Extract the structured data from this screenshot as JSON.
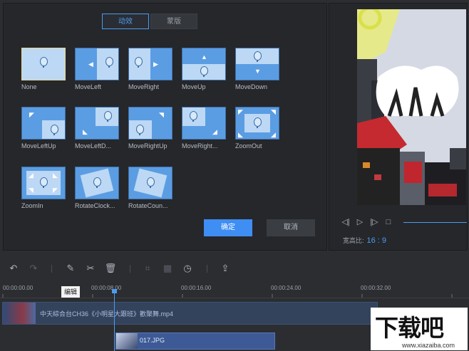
{
  "tabs": [
    {
      "label": "动效",
      "active": true
    },
    {
      "label": "蒙版",
      "active": false
    }
  ],
  "effects": [
    {
      "label": "None",
      "selected": true
    },
    {
      "label": "MoveLeft"
    },
    {
      "label": "MoveRight"
    },
    {
      "label": "MoveUp"
    },
    {
      "label": "MoveDown"
    },
    {
      "label": "MoveLeftUp"
    },
    {
      "label": "MoveLeftD..."
    },
    {
      "label": "MoveRightUp"
    },
    {
      "label": "MoveRight..."
    },
    {
      "label": "ZoomOut"
    },
    {
      "label": "ZoomIn"
    },
    {
      "label": "RotateClock..."
    },
    {
      "label": "RotateCoun..."
    }
  ],
  "buttons": {
    "ok": "确定",
    "cancel": "取消"
  },
  "preview": {
    "aspect_label": "宽高比:",
    "aspect_value": "16 : 9",
    "controls": [
      "prev-frame-icon",
      "play-icon",
      "next-frame-icon",
      "stop-icon"
    ]
  },
  "toolbar": {
    "tools": [
      "undo-icon",
      "redo-icon",
      "edit-icon",
      "cut-icon",
      "delete-icon",
      "crop-icon",
      "mosaic-icon",
      "speed-icon",
      "export-icon"
    ]
  },
  "timeline": {
    "ticks": [
      "00:00:00.00",
      "00:00:08.00",
      "00:00:16.00",
      "00:00:24.00",
      "00:00:32.00"
    ],
    "tooltip": "编辑",
    "track1_name": "中天綜合台CH36《小明星大跟班》歡聚舞.mp4",
    "track2_name": "017.JPG"
  },
  "watermark": {
    "title": "下载吧",
    "url": "www.xiazaiba.com"
  },
  "colors": {
    "accent": "#4c9cf0",
    "thumb_blue": "#5b9de3",
    "selected_border": "#e9d88a"
  }
}
